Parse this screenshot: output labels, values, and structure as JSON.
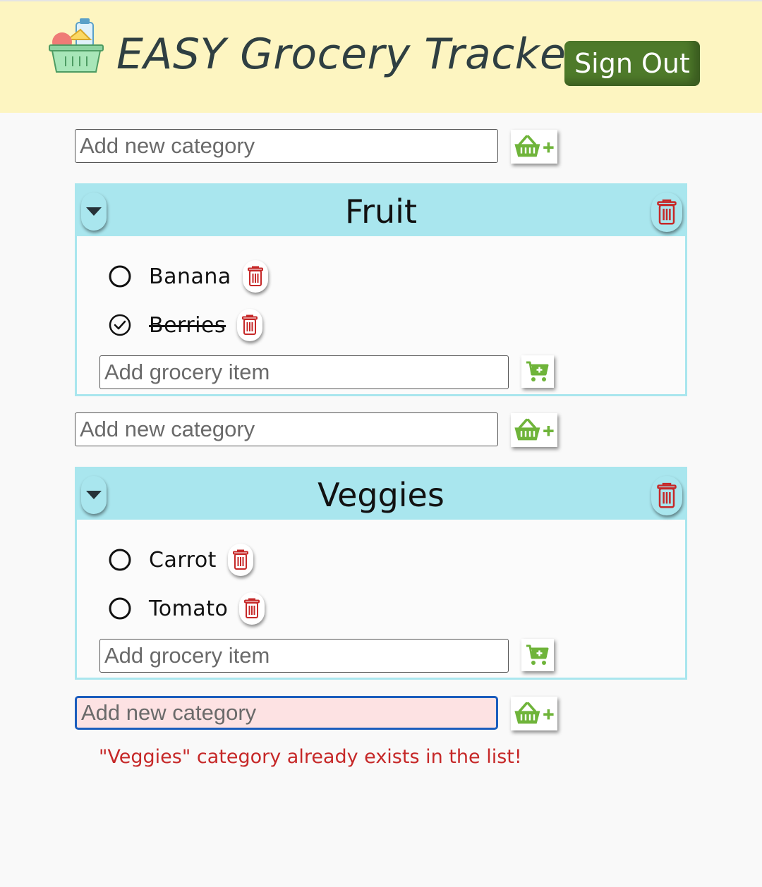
{
  "header": {
    "title": "EASY Grocery Tracker",
    "sign_out_label": "Sign Out"
  },
  "add_category_placeholder": "Add new category",
  "add_item_placeholder": "Add grocery item",
  "categories": [
    {
      "name": "Fruit",
      "items": [
        {
          "name": "Banana",
          "checked": false
        },
        {
          "name": "Berries",
          "checked": true
        }
      ]
    },
    {
      "name": "Veggies",
      "items": [
        {
          "name": "Carrot",
          "checked": false
        },
        {
          "name": "Tomato",
          "checked": false
        }
      ]
    }
  ],
  "error_message": "\"Veggies\" category already exists in the list!",
  "colors": {
    "header_bg": "#fdf5c1",
    "category_accent": "#a9e6ee",
    "sign_out_bg": "#4e7a2a",
    "delete_red": "#c62828",
    "add_green": "#6fb43a",
    "error_bg": "#fde2e3"
  }
}
